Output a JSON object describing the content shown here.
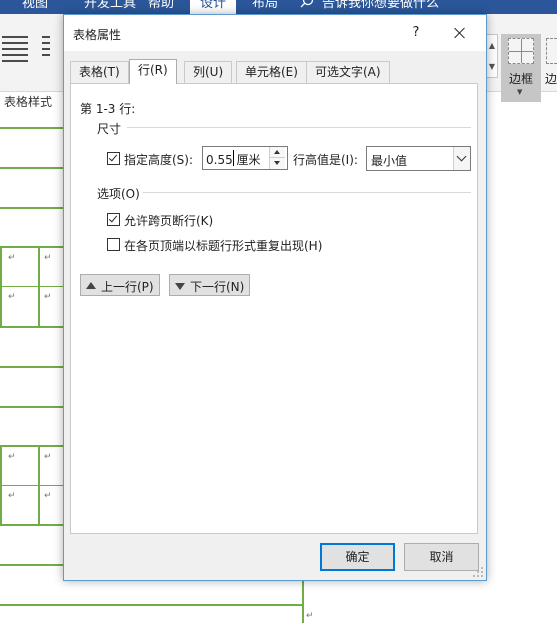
{
  "ribbon": {
    "tabs": [
      "视图",
      "开发工具",
      "帮助",
      "设计",
      "布局"
    ],
    "active_tab": "设计",
    "tell_me": "告诉我你想要做什么",
    "table_styles_label": "表格样式",
    "borders_label": "边框",
    "borders_label_2": "边"
  },
  "dialog": {
    "title": "表格属性",
    "help_label": "?",
    "tabs": [
      "表格(T)",
      "行(R)",
      "列(U)",
      "单元格(E)",
      "可选文字(A)"
    ],
    "active_tab": "行(R)",
    "rows_label": "第 1-3 行:",
    "size": {
      "section_title": "尺寸",
      "specify_height_label": "指定高度(S):",
      "specify_height_checked": true,
      "height_value": "0.55 厘米",
      "row_height_is_label": "行高值是(I):",
      "row_height_mode": "最小值"
    },
    "options": {
      "section_title": "选项(O)",
      "allow_break_label": "允许跨页断行(K)",
      "allow_break_checked": true,
      "repeat_header_label": "在各页顶端以标题行形式重复出现(H)",
      "repeat_header_checked": false
    },
    "nav": {
      "prev_row_label": "上一行(P)",
      "next_row_label": "下一行(N)"
    },
    "buttons": {
      "ok_label": "确定",
      "cancel_label": "取消"
    }
  },
  "document": {
    "cell_mark": "↵"
  },
  "colors": {
    "ribbon_blue": "#2b579a",
    "table_border_green": "#70ad47",
    "dialog_border": "#5b9bd5",
    "default_button_border": "#0078d7"
  }
}
